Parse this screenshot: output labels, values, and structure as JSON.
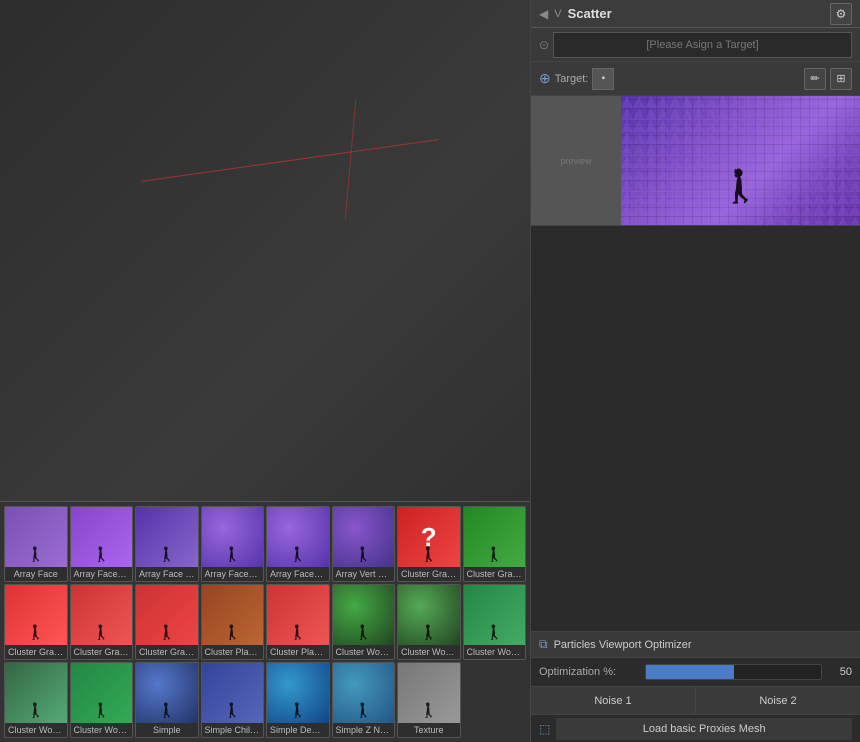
{
  "app": {
    "title": "Scatter"
  },
  "header": {
    "v_label": "V",
    "title": "Scatter",
    "settings_icon": "⚙"
  },
  "assign_bar": {
    "placeholder": "[Please Asign a Target]"
  },
  "target_bar": {
    "label": "Target:",
    "pencil_icon": "✏",
    "grid_icon": "⊞"
  },
  "optimizer": {
    "header": "Particles Viewport Optimizer",
    "optimization_label": "Optimization %:",
    "optimization_value": "50",
    "optimization_percent": 50,
    "noise1_label": "Noise 1",
    "noise2_label": "Noise 2",
    "load_basic_label": "Load basic Proxies Mesh"
  },
  "grid_items": [
    {
      "id": "array-face",
      "label": "Array Face",
      "thumb": "purple-array"
    },
    {
      "id": "array-face-band",
      "label": "Array Face Band",
      "thumb": "purple-band"
    },
    {
      "id": "array-face-text",
      "label": "Array Face Text..",
      "thumb": "purple-dots"
    },
    {
      "id": "array-face-z-n1",
      "label": "Array Face Z N..",
      "thumb": "sphere-purple"
    },
    {
      "id": "array-face-z-n2",
      "label": "Array Face Z N..",
      "thumb": "sphere-purple"
    },
    {
      "id": "array-vert-z-no",
      "label": "Array Vert Z No..",
      "thumb": "vert-purple"
    },
    {
      "id": "cluster-grass-a",
      "label": "Cluster Grass A..",
      "thumb": "grass-a"
    },
    {
      "id": "cluster-grass-l",
      "label": "Cluster Grass L",
      "thumb": "grass-l"
    },
    {
      "id": "cluster-grass-m",
      "label": "Cluster Grass M",
      "thumb": "grass-m"
    },
    {
      "id": "cluster-grass-s",
      "label": "Cluster Grass S",
      "thumb": "grass-s"
    },
    {
      "id": "cluster-grass-z",
      "label": "Cluster Grass Z ..",
      "thumb": "grass-z"
    },
    {
      "id": "cluster-plant-m",
      "label": "Cluster Plant M",
      "thumb": "plant-m"
    },
    {
      "id": "cluster-plant-s",
      "label": "Cluster Plant S",
      "thumb": "plant-s"
    },
    {
      "id": "cluster-wood-c",
      "label": "Cluster Wood C..",
      "thumb": "wood-c"
    },
    {
      "id": "cluster-wood-d",
      "label": "Cluster Wood D..",
      "thumb": "wood-d"
    },
    {
      "id": "cluster-wood-l",
      "label": "Cluster Wood L ..",
      "thumb": "wood-l"
    },
    {
      "id": "cluster-wood-m",
      "label": "Cluster Wood M",
      "thumb": "wood-m"
    },
    {
      "id": "cluster-wood-z",
      "label": "Cluster Wood Z ..",
      "thumb": "wood-z"
    },
    {
      "id": "simple",
      "label": "Simple",
      "thumb": "simple"
    },
    {
      "id": "simple-children",
      "label": "Simple Children",
      "thumb": "simple-children"
    },
    {
      "id": "simple-dense",
      "label": "Simple Dense",
      "thumb": "simple-dense"
    },
    {
      "id": "simple-z-normal",
      "label": "Simple Z Normal",
      "thumb": "simple-z"
    },
    {
      "id": "texture",
      "label": "Texture",
      "thumb": "texture"
    }
  ],
  "thumb_colors": {
    "purple-array": "#7a4fb5",
    "purple-band": "#9955dd",
    "purple-dots": "#6644bb",
    "sphere-purple": "#7755cc",
    "vert-purple": "#6644bb",
    "grass-a": "#cc3333",
    "grass-l": "#228822",
    "grass-m": "#dd3333",
    "grass-s": "#cc3333",
    "grass-z": "#cc3333",
    "plant-m": "#994422",
    "plant-s": "#cc3333",
    "wood-c": "#44aa44",
    "wood-d": "#55aa55",
    "wood-l": "#228844",
    "wood-m": "#336644",
    "wood-z": "#228844",
    "simple": "#5577cc",
    "simple-children": "#334499",
    "simple-dense": "#3399cc",
    "simple-z": "#4499bb",
    "texture": "#888888"
  }
}
